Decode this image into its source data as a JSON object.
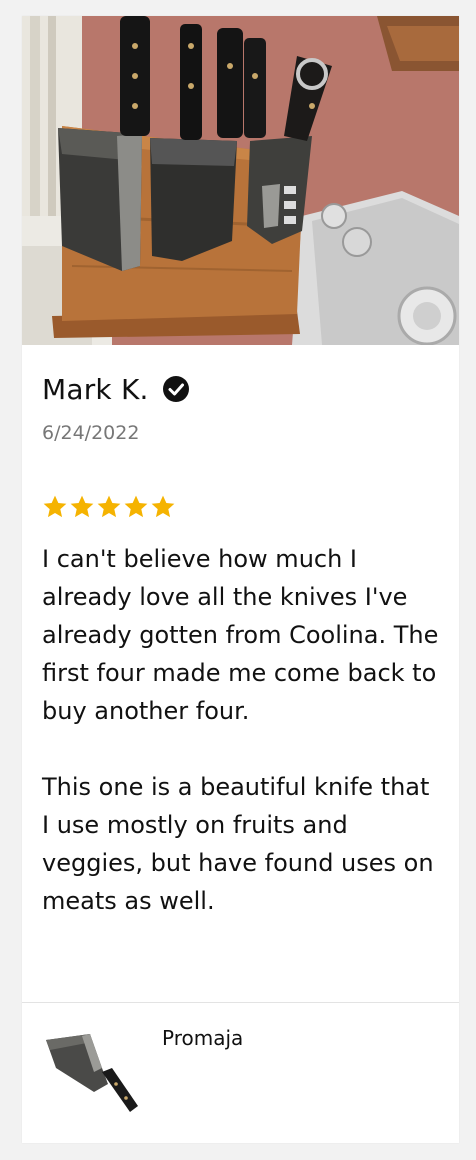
{
  "review": {
    "reviewer_name": "Mark K.",
    "verified_icon": "verified-check-icon",
    "date": "6/24/2022",
    "rating": 5,
    "rating_max": 5,
    "star_color": "#f5b301",
    "paragraphs": [
      "I can't believe how much I already love all the knives I've already gotten from Coolina. The first four made me come back to buy another four.",
      "This one is a beautiful knife that I use mostly on fruits and veggies, but have found uses on meats as well."
    ]
  },
  "photo": {
    "icon": "knife-block-photo"
  },
  "product": {
    "name": "Promaja",
    "thumbnail_icon": "cleaver-knife-icon"
  }
}
